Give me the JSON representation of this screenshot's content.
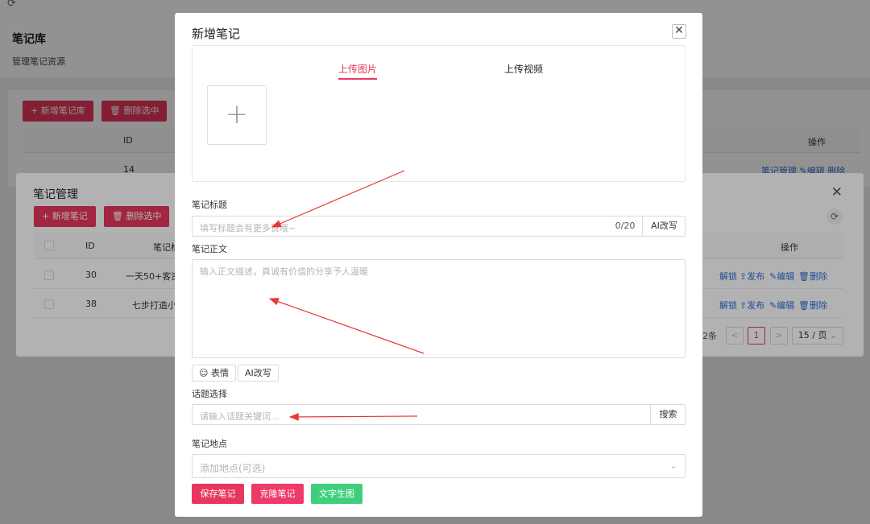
{
  "background_page": {
    "title": "笔记库",
    "subtitle": "管理笔记资源",
    "add_button": "+ 新增笔记库",
    "delete_button": "删除选中",
    "col_id": "ID",
    "col_ops": "操作",
    "row_id": "14",
    "row_ops": "笔记管理 ✎编辑 删除"
  },
  "note_manage_dialog": {
    "title": "笔记管理",
    "add_button": "+ 新增笔记",
    "delete_button": "删除选中",
    "columns": {
      "id": "ID",
      "title": "笔记标",
      "ops": "操作"
    },
    "rows": [
      {
        "id": "30",
        "title": "一天50+客资",
        "unlock": "解锁",
        "publish": "发布",
        "edit": "编辑",
        "delete": "删除"
      },
      {
        "id": "38",
        "title": "七步打造小",
        "unlock": "解锁",
        "publish": "发布",
        "edit": "编辑",
        "delete": "删除"
      }
    ],
    "pager": {
      "total": "2条",
      "prev": "<",
      "page": "1",
      "next": ">",
      "size": "15 / 页"
    }
  },
  "dialog": {
    "title": "新增笔记",
    "tabs": [
      "上传图片",
      "上传视频"
    ],
    "title_label": "笔记标题",
    "title_placeholder": "填写标题会有更多赞哦~",
    "title_count": "0/20",
    "ai_rewrite": "AI改写",
    "body_label": "笔记正文",
    "body_placeholder": "输入正文描述，真诚有价值的分享予人温暖",
    "emoji_button": "表情",
    "body_ai_button": "AI改写",
    "topic_label": "话题选择",
    "topic_placeholder": "请输入话题关键词...",
    "search_button": "搜索",
    "location_label": "笔记地点",
    "location_placeholder": "添加地点(可选)",
    "save_button": "保存笔记",
    "clone_button": "克隆笔记",
    "image_gen_button": "文字生图"
  },
  "colors": {
    "accent": "#e8365d",
    "green": "#3fcf7c",
    "link": "#2f6fd6",
    "arrow": "#e53935"
  },
  "icons": [
    "refresh-icon",
    "close-icon",
    "plus-icon",
    "trash-icon",
    "emoji-icon",
    "chevron-down-icon",
    "upload-icon",
    "edit-icon",
    "lock-icon"
  ]
}
